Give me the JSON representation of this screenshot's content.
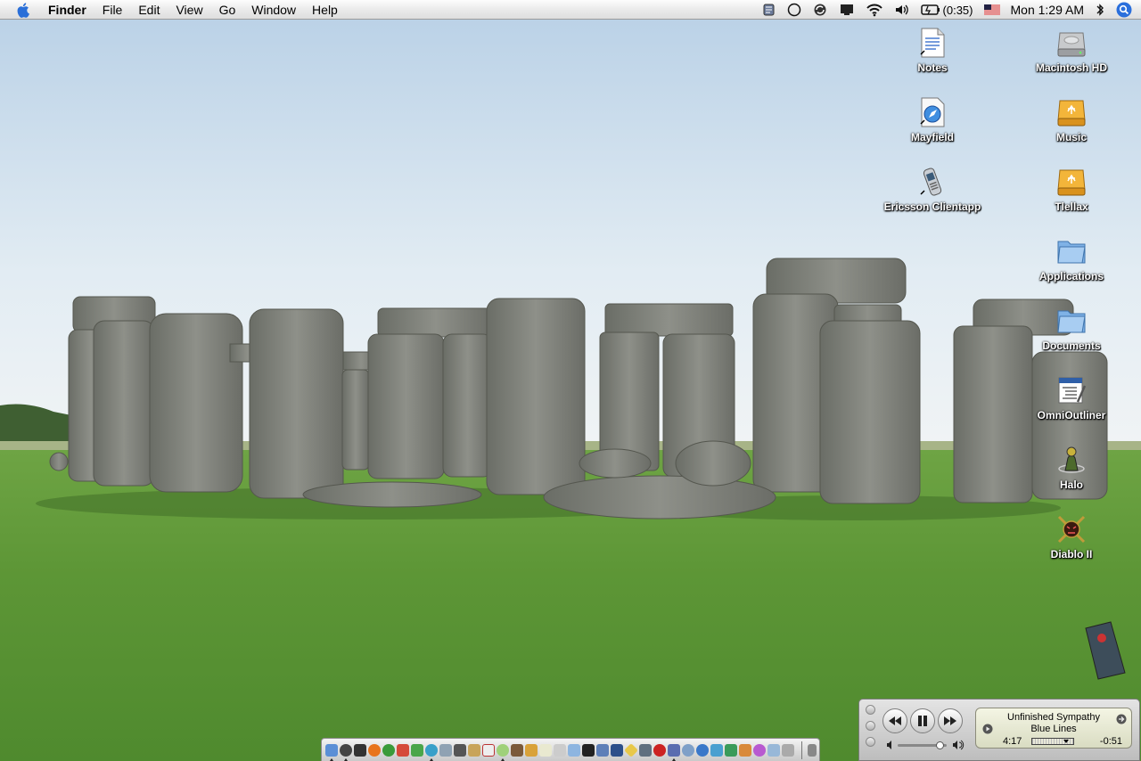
{
  "menubar": {
    "app_name": "Finder",
    "menus": [
      "File",
      "Edit",
      "View",
      "Go",
      "Window",
      "Help"
    ],
    "battery_text": "(0:35)",
    "clock": "Mon 1:29 AM"
  },
  "desktop_icons": [
    {
      "label": "Notes",
      "icon": "document-icon"
    },
    {
      "label": "Mayfield",
      "icon": "safari-document-icon"
    },
    {
      "label": "Ericsson Clientapp",
      "icon": "phone-icon"
    },
    {
      "label": "Macintosh HD",
      "icon": "hard-drive-icon"
    },
    {
      "label": "Music",
      "icon": "firewire-drive-icon"
    },
    {
      "label": "Tlellax",
      "icon": "firewire-drive-icon"
    },
    {
      "label": "Applications",
      "icon": "folder-icon"
    },
    {
      "label": "Documents",
      "icon": "folder-icon"
    },
    {
      "label": "OmniOutliner",
      "icon": "omnioutliner-icon"
    },
    {
      "label": "Halo",
      "icon": "halo-icon"
    },
    {
      "label": "Diablo II",
      "icon": "diablo-icon"
    }
  ],
  "itunes": {
    "song": "Unfinished Sympathy",
    "artist": "Blue Lines",
    "elapsed": "4:17",
    "remaining": "-0:51",
    "progress": 0.83,
    "volume": 0.85
  },
  "colors": {
    "sky_top": "#bfd6ea",
    "grass": "#5f9a3a",
    "stone": "#7d7f78",
    "label_text": "#ffffff"
  }
}
